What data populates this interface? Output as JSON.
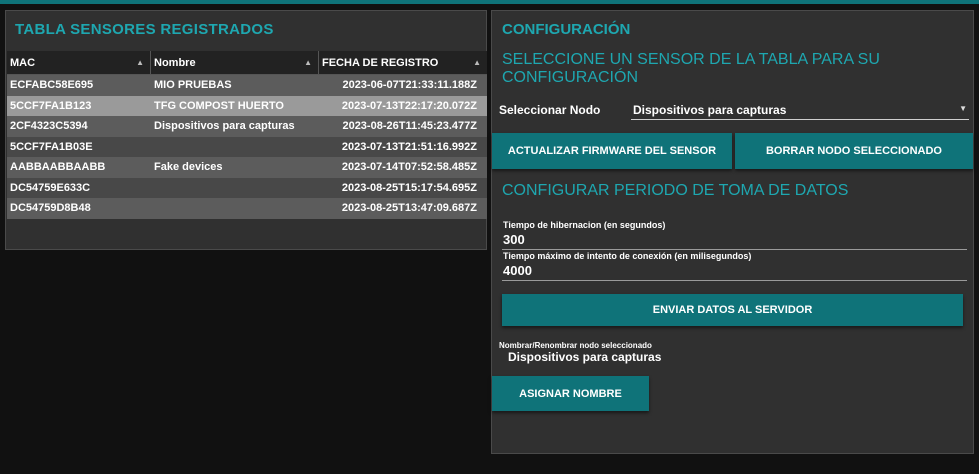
{
  "sensors_panel": {
    "title": "TABLA SENSORES REGISTRADOS",
    "columns": [
      "MAC",
      "Nombre",
      "FECHA DE REGISTRO"
    ],
    "rows": [
      {
        "mac": "ECFABC58E695",
        "name": "MIO PRUEBAS",
        "date": "2023-06-07T21:33:11.188Z"
      },
      {
        "mac": "5CCF7FA1B123",
        "name": "TFG COMPOST HUERTO",
        "date": "2023-07-13T22:17:20.072Z"
      },
      {
        "mac": "2CF4323C5394",
        "name": "Dispositivos para capturas",
        "date": "2023-08-26T11:45:23.477Z"
      },
      {
        "mac": "5CCF7FA1B03E",
        "name": "",
        "date": "2023-07-13T21:51:16.992Z"
      },
      {
        "mac": "AABBAABBAABB",
        "name": "Fake devices",
        "date": "2023-07-14T07:52:58.485Z"
      },
      {
        "mac": "DC54759E633C",
        "name": "",
        "date": "2023-08-25T15:17:54.695Z"
      },
      {
        "mac": "DC54759D8B48",
        "name": "",
        "date": "2023-08-25T13:47:09.687Z"
      }
    ],
    "selected_row": 1
  },
  "config_panel": {
    "title": "CONFIGURACIÓN",
    "subtitle": "SELECCIONE UN SENSOR DE LA TABLA PARA SU CONFIGURACIÓN",
    "node_label": "Seleccionar Nodo",
    "node_value": "Dispositivos para capturas",
    "update_firmware_label": "ACTUALIZAR FIRMWARE DEL SENSOR",
    "delete_node_label": "BORRAR NODO SELECCIONADO",
    "period_title": "CONFIGURAR PERIODO DE TOMA DE DATOS",
    "sleep_label": "Tiempo de hibernacion (en segundos)",
    "sleep_value": "300",
    "timeout_label": "Tiempo máximo de intento de conexión (en milisegundos)",
    "timeout_value": "4000",
    "send_label": "ENVIAR DATOS AL SERVIDOR",
    "rename_label": "Nombrar/Renombrar nodo seleccionado",
    "rename_value": "Dispositivos para capturas",
    "assign_label": "ASIGNAR NOMBRE"
  },
  "colors": {
    "accent": "#1ea7b0",
    "button": "#0f7379",
    "panel": "#303030",
    "background": "#111111"
  },
  "icons": {
    "sort": "sort-up-icon",
    "dropdown": "caret-down-icon"
  }
}
